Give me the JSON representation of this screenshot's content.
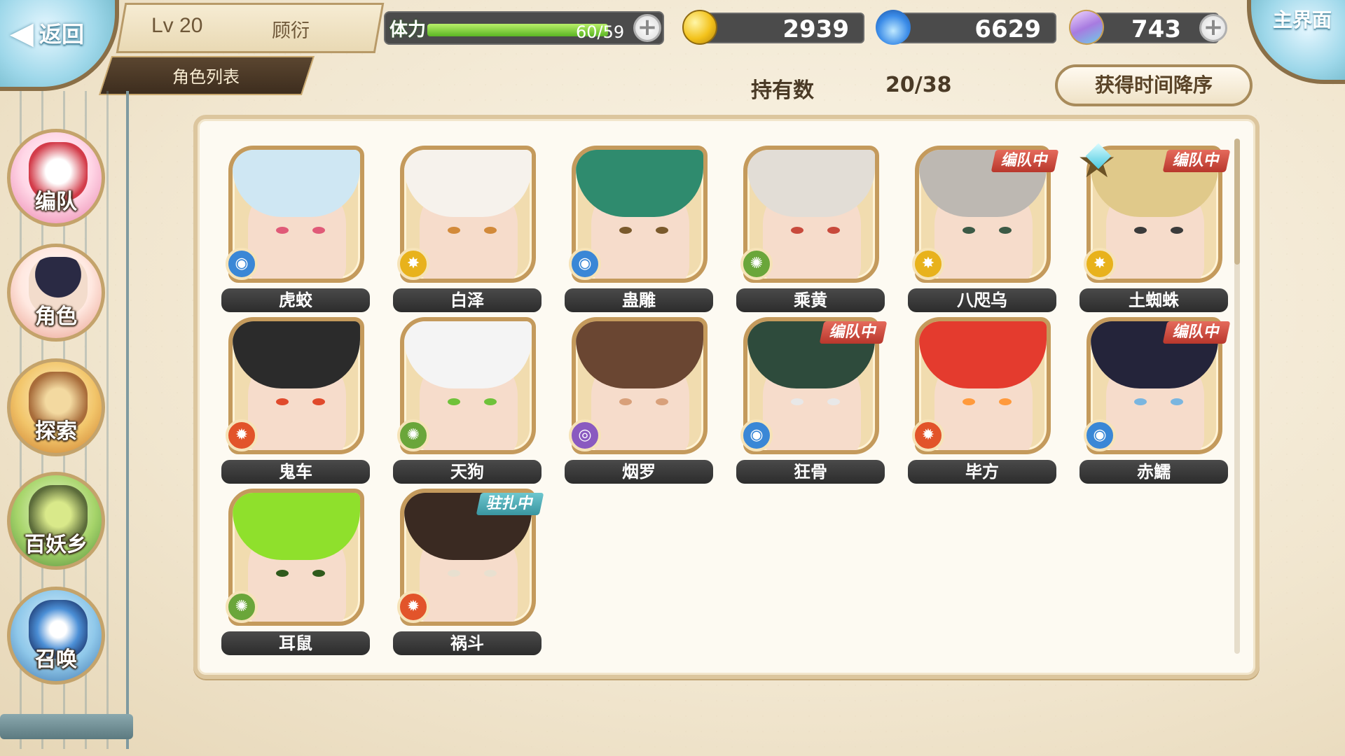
{
  "topbar": {
    "back_label": "返回",
    "level": "Lv 20",
    "player_name": "顾衍",
    "tab_label": "角色列表",
    "stamina_label": "体力",
    "stamina_value": "60/59",
    "stamina_fraction": 1.0,
    "coins": "2939",
    "soul_fire": "6629",
    "crystals": "743",
    "home_label": "主界面"
  },
  "summary": {
    "owned_label": "持有数",
    "owned_value": "20/38",
    "sort_label": "获得时间降序"
  },
  "sidenav": [
    {
      "label": "编队",
      "icon": "team-icon"
    },
    {
      "label": "角色",
      "icon": "character-icon"
    },
    {
      "label": "探索",
      "icon": "explore-icon"
    },
    {
      "label": "百妖乡",
      "icon": "village-icon"
    },
    {
      "label": "召唤",
      "icon": "summon-icon"
    }
  ],
  "characters": [
    {
      "name": "虎蛟",
      "element": "water",
      "tag": "",
      "hair": "#cfe7f3",
      "accent": "#e05a78"
    },
    {
      "name": "白泽",
      "element": "light",
      "tag": "",
      "hair": "#f6f2ec",
      "accent": "#d28a3a"
    },
    {
      "name": "蛊雕",
      "element": "water",
      "tag": "",
      "hair": "#2f8b6e",
      "accent": "#7a5a2c"
    },
    {
      "name": "乘黄",
      "element": "wind",
      "tag": "",
      "hair": "#e2ddd6",
      "accent": "#c84a3c"
    },
    {
      "name": "八咫乌",
      "element": "light",
      "tag": "编队中",
      "hair": "#bdb8b2",
      "accent": "#3c5a46"
    },
    {
      "name": "土蜘蛛",
      "element": "light",
      "tag": "编队中",
      "hair": "#e0c98a",
      "accent": "#3b3b3b",
      "star": true
    },
    {
      "name": "鬼车",
      "element": "fire",
      "tag": "",
      "hair": "#2b2b2b",
      "accent": "#e04a2c"
    },
    {
      "name": "天狗",
      "element": "wind",
      "tag": "",
      "hair": "#f4f4f4",
      "accent": "#6fc23a"
    },
    {
      "name": "烟罗",
      "element": "dark",
      "tag": "",
      "hair": "#6a4632",
      "accent": "#d8a07a"
    },
    {
      "name": "狂骨",
      "element": "water",
      "tag": "编队中",
      "hair": "#2e4b3c",
      "accent": "#e8e8e8"
    },
    {
      "name": "毕方",
      "element": "fire",
      "tag": "",
      "hair": "#e43b2e",
      "accent": "#ff9a3c"
    },
    {
      "name": "赤鱬",
      "element": "water",
      "tag": "编队中",
      "hair": "#24243a",
      "accent": "#7ab6e0"
    },
    {
      "name": "耳鼠",
      "element": "wind",
      "tag": "",
      "hair": "#8fe02c",
      "accent": "#2f5a1c"
    },
    {
      "name": "祸斗",
      "element": "fire",
      "tag": "驻扎中",
      "hair": "#3a2a22",
      "accent": "#e8e0d0"
    }
  ],
  "element_colors": {
    "water": "#3a87d6",
    "light": "#e8b21c",
    "wind": "#6aa63a",
    "fire": "#e2542a",
    "dark": "#8a5ac0"
  }
}
